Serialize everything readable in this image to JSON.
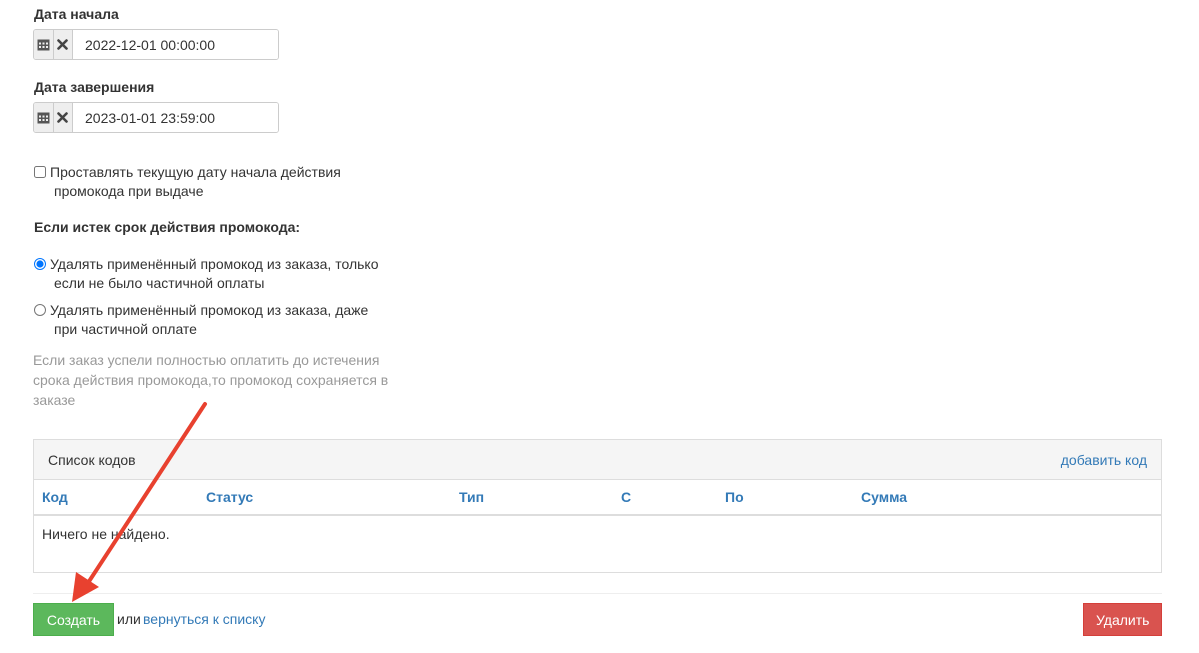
{
  "start": {
    "label": "Дата начала",
    "value": "2022-12-01 00:00:00"
  },
  "end": {
    "label": "Дата завершения",
    "value": "2023-01-01 23:59:00"
  },
  "auto_date": {
    "line1": "Проставлять текущую дату начала действия",
    "line2": "промокода при выдаче",
    "checked": false
  },
  "expiry": {
    "heading": "Если истек срок действия промокода:",
    "options": [
      {
        "line1": "Удалять применённый промокод из заказа, только",
        "line2": "если не было частичной оплаты",
        "selected": true
      },
      {
        "line1": "Удалять применённый промокод из заказа, даже",
        "line2": "при частичной оплате",
        "selected": false
      }
    ],
    "hint": "Если заказ успели полностью оплатить до истечения срока действия промокода,то промокод сохраняется в заказе"
  },
  "codes": {
    "title": "Список кодов",
    "add_link": "добавить код",
    "columns": [
      "Код",
      "Статус",
      "Тип",
      "С",
      "По",
      "Сумма"
    ],
    "empty": "Ничего не найдено."
  },
  "footer": {
    "create": "Создать",
    "or": "или",
    "back": "вернуться к списку",
    "delete": "Удалить"
  },
  "colors": {
    "link": "#337ab7",
    "create": "#5cb85c",
    "delete": "#d9534f",
    "annotation_arrow": "#e8412f"
  }
}
